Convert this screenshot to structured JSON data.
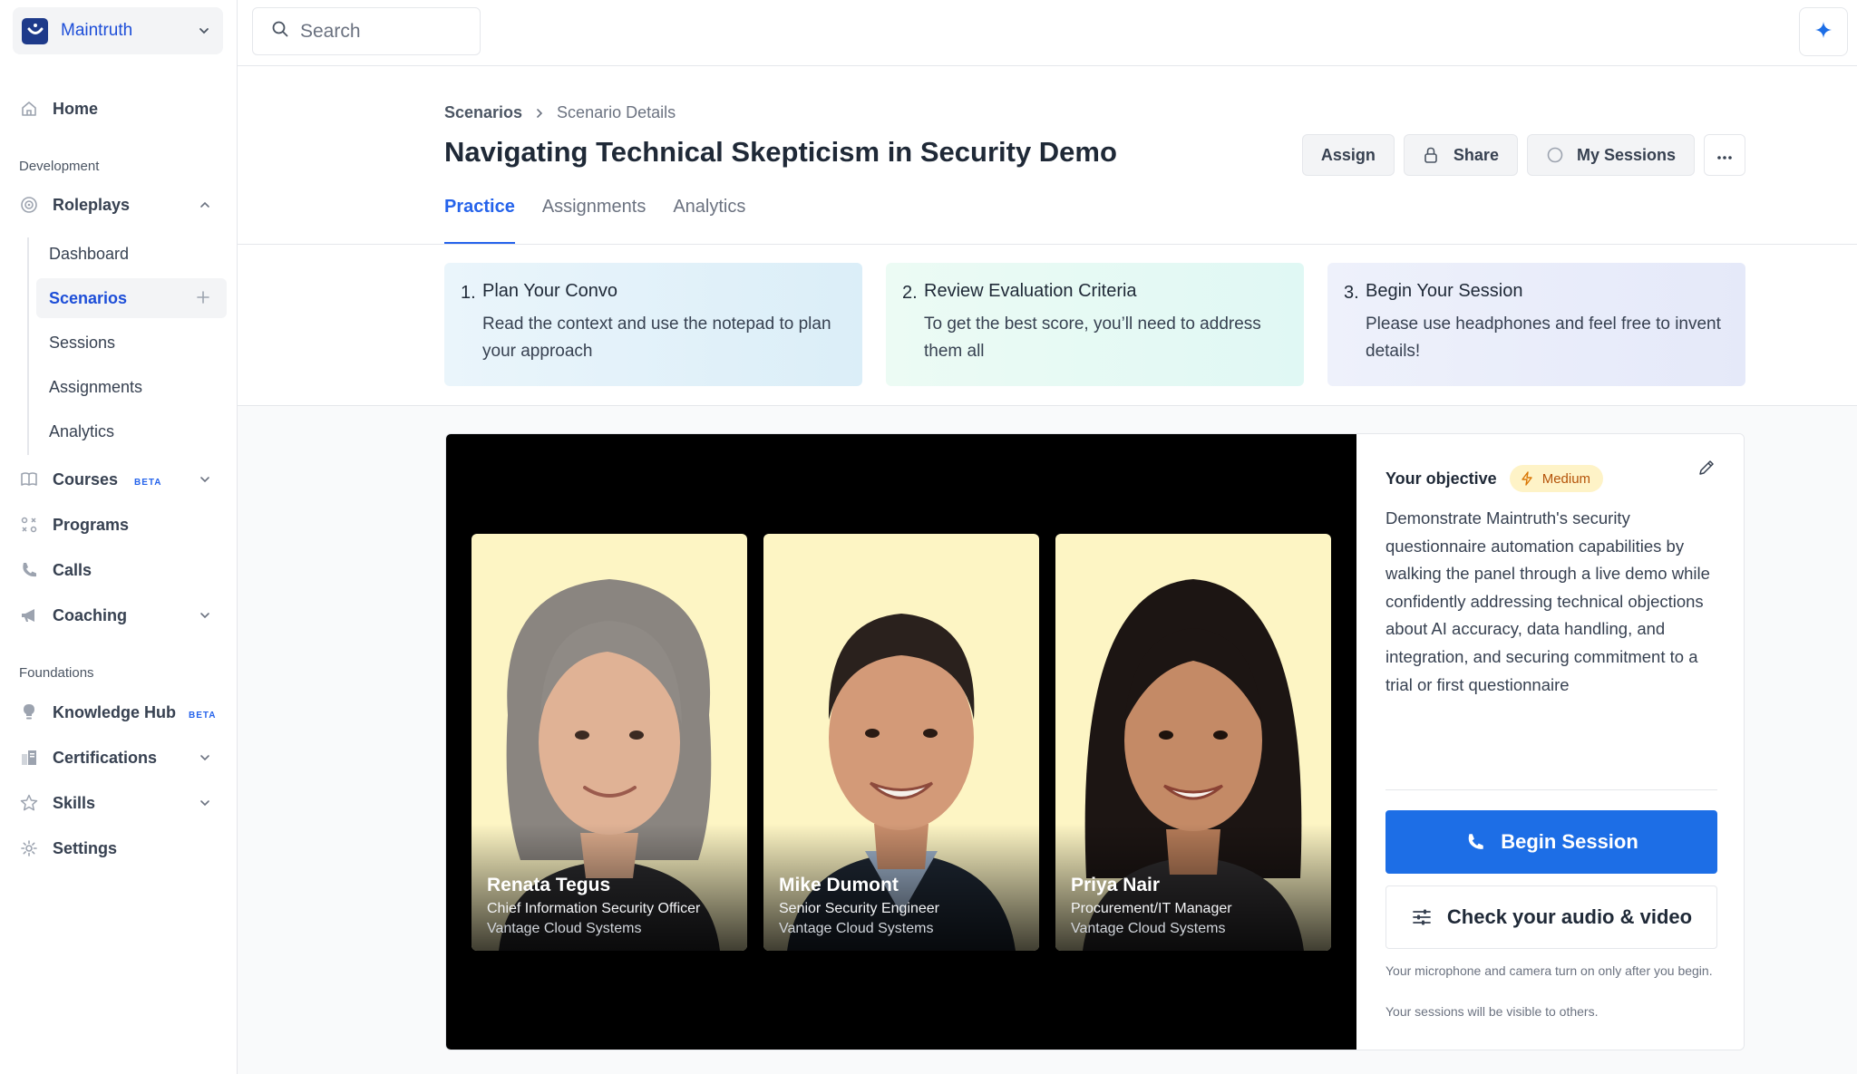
{
  "org": {
    "name": "Maintruth"
  },
  "search": {
    "placeholder": "Search"
  },
  "sidebar": {
    "home": "Home",
    "section_development": "Development",
    "roleplays": "Roleplays",
    "roleplay_items": [
      "Dashboard",
      "Scenarios",
      "Sessions",
      "Assignments",
      "Analytics"
    ],
    "courses": "Courses",
    "beta_label": "BETA",
    "programs": "Programs",
    "calls": "Calls",
    "coaching": "Coaching",
    "section_foundations": "Foundations",
    "knowledge_hub": "Knowledge Hub",
    "certifications": "Certifications",
    "skills": "Skills",
    "settings": "Settings"
  },
  "breadcrumb": {
    "parent": "Scenarios",
    "current": "Scenario Details"
  },
  "page": {
    "title": "Navigating Technical Skepticism in Security Demo"
  },
  "actions": {
    "assign": "Assign",
    "share": "Share",
    "my_sessions": "My Sessions"
  },
  "tabs": [
    "Practice",
    "Assignments",
    "Analytics"
  ],
  "steps": [
    {
      "num": "1.",
      "title": "Plan Your Convo",
      "desc": "Read the context and use the notepad to plan your approach"
    },
    {
      "num": "2.",
      "title": "Review Evaluation Criteria",
      "desc": "To get the best score, you’ll need to address them all"
    },
    {
      "num": "3.",
      "title": "Begin Your Session",
      "desc": "Please use headphones and feel free to invent details!"
    }
  ],
  "personas": [
    {
      "name": "Renata Tegus",
      "role": "Chief Information Security Officer",
      "company": "Vantage Cloud Systems"
    },
    {
      "name": "Mike Dumont",
      "role": "Senior Security Engineer",
      "company": "Vantage Cloud Systems"
    },
    {
      "name": "Priya Nair",
      "role": "Procurement/IT Manager",
      "company": "Vantage Cloud Systems"
    }
  ],
  "objective": {
    "label": "Your objective",
    "difficulty": "Medium",
    "text": "Demonstrate Maintruth's security questionnaire automation capabilities by walking the panel through a live demo while confidently addressing technical objections about AI accuracy, data handling, and integration, and securing commitment to a trial or first questionnaire"
  },
  "session": {
    "begin_label": "Begin Session",
    "check_label": "Check your audio & video",
    "note": "Your microphone and camera turn on only after you begin.",
    "visibility_note": "Your sessions will be visible to others."
  },
  "colors": {
    "accent": "#1d6ee6",
    "badge_bg": "#fef3c7",
    "badge_text": "#b45309",
    "persona_bg": "#fdf5c4"
  }
}
